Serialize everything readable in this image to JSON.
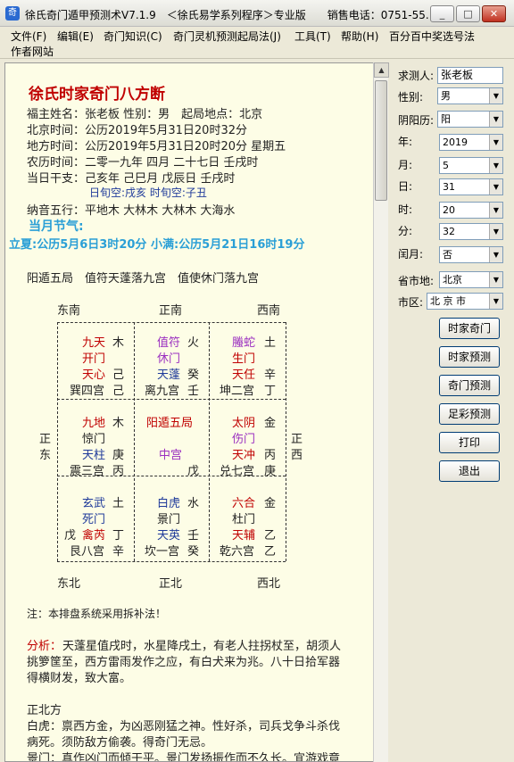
{
  "window": {
    "title": "徐氏奇门遁甲预测术V7.1.9　＜徐氏易学系列程序＞专业版　　销售电话：0751-55...",
    "min": "_",
    "max": "□",
    "close": "✕",
    "icon": "奇"
  },
  "menu": [
    "文件(F)",
    "编辑(E)",
    "奇门知识(C)",
    "奇门灵机预测起局法(J)",
    "工具(T)",
    "帮助(H)",
    "百分百中奖选号法",
    "作者网站"
  ],
  "report": {
    "heading": "徐氏时家奇门八方断",
    "lines": [
      "福主姓名：张老板 性别：男　起局地点：北京",
      "北京时间：公历2019年5月31日20时32分",
      "地方时间：公历2019年5月31日20时20分 星期五",
      "农历时间：二零一九年 四月 二十七日 壬戌时",
      "当日干支：己亥年 己巳月 戊辰日 壬戌时"
    ],
    "xunkong": "日旬空:戌亥 时旬空:子丑",
    "nayin": "纳音五行：平地木 大林木 大林木 大海水",
    "jieqi_title": "当月节气:",
    "jieqi": "立夏:公历5月6日3时20分 小满:公历5月21日16时19分",
    "summary": "阳遁五局　值符天蓬落九宫　值使休门落九宫",
    "directions": {
      "se": "东南",
      "s": "正南",
      "sw": "西南",
      "e1": "正",
      "e2": "东",
      "w1": "正",
      "w2": "西",
      "ne": "东北",
      "n": "正北",
      "nw": "西北"
    },
    "palaces": [
      {
        "shen": "九天",
        "shen_el": "木",
        "men": "开门",
        "xing": "天心",
        "xing_gan": "己",
        "gong": "巽四宫",
        "gong_gan": "己"
      },
      {
        "shen": "值符",
        "shen_el": "火",
        "men": "休门",
        "xing": "天蓬",
        "xing_gan": "癸",
        "gong": "离九宫",
        "gong_gan": "壬"
      },
      {
        "shen": "螣蛇",
        "shen_el": "土",
        "men": "生门",
        "xing": "天任",
        "xing_gan": "辛",
        "gong": "坤二宫",
        "gong_gan": "丁"
      },
      {
        "shen": "九地",
        "shen_el": "木",
        "men": "惊门",
        "xing": "天柱",
        "xing_gan": "庚",
        "gong": "震三宫",
        "gong_gan": "丙"
      },
      {
        "shen": "阳遁五局",
        "shen_el": "",
        "men": "",
        "xing": "中宫",
        "xing_gan": "",
        "gong": "",
        "gong_gan": "戊"
      },
      {
        "shen": "太阴",
        "shen_el": "金",
        "men": "伤门",
        "xing": "天冲",
        "xing_gan": "丙",
        "gong": "兑七宫",
        "gong_gan": "庚"
      },
      {
        "shen": "玄武",
        "shen_el": "土",
        "men": "死门",
        "xing": "禽芮",
        "xing_gan": "丁",
        "gong": "艮八宫",
        "gong_gan": "辛",
        "extra": "戊"
      },
      {
        "shen": "白虎",
        "shen_el": "水",
        "men": "景门",
        "xing": "天英",
        "xing_gan": "壬",
        "gong": "坎一宫",
        "gong_gan": "癸"
      },
      {
        "shen": "六合",
        "shen_el": "金",
        "men": "杜门",
        "xing": "天辅",
        "xing_gan": "乙",
        "gong": "乾六宫",
        "gong_gan": "乙"
      }
    ],
    "note": "注：本排盘系统采用拆补法！",
    "analysis_label": "分析：",
    "analysis1": "天蓬星值戌时，水星降戌土，有老人拄拐杖至，胡须人",
    "analysis2": "挑箩筐至，西方雷雨发作之应，有白犬来为兆。八十日拾军器",
    "analysis3": "得横财发，致大富。",
    "dir_title": "正北方",
    "baihu1": "白虎：禀西方金，为凶恶刚猛之神。性好杀，司兵戈争斗杀伐",
    "baihu2": "病死。须防敌方偷袭。得奇门无忌。",
    "jingmen": "景门：真作凶门而倾干平。景门发扬振作而不久长。宜游戏竟"
  },
  "form": {
    "name_label": "求测人:",
    "name_value": "张老板",
    "gender_label": "性别:",
    "gender_value": "男",
    "calendar_label": "阴阳历:",
    "calendar_value": "阳",
    "year_label": "年:",
    "year_value": "2019",
    "month_label": "月:",
    "month_value": "5",
    "day_label": "日:",
    "day_value": "31",
    "hour_label": "时:",
    "hour_value": "20",
    "minute_label": "分:",
    "minute_value": "32",
    "leap_label": "闰月:",
    "leap_value": "否",
    "province_label": "省市地:",
    "province_value": "北京",
    "city_label": "市区:",
    "city_value": "北 京 市"
  },
  "buttons": [
    "时家奇门",
    "时家预测",
    "奇门预测",
    "足彩预测",
    "打印",
    "退出"
  ]
}
